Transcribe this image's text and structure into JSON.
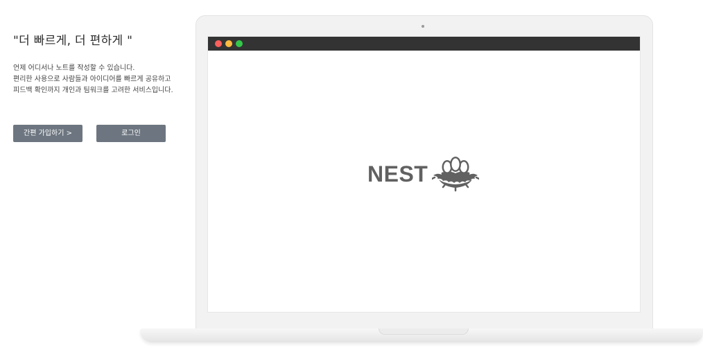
{
  "hero": {
    "headline": "\"더 빠르게, 더 편하게 \"",
    "description_lines": [
      "언제 어디서나 노트를 작성할 수 있습니다.",
      "편리한 사용으로 사람들과 아이디어를 빠르게 공유하고",
      "피드백 확인까지 개인과 팀워크를 고려한 서비스입니다."
    ]
  },
  "buttons": {
    "signup_label": "간편 가입하기 >",
    "login_label": "로그인"
  },
  "mockup": {
    "logo_text": "NEST",
    "logo_icon": "nest-eggs-icon",
    "window_controls": [
      "close",
      "minimize",
      "maximize"
    ]
  },
  "colors": {
    "button_bg": "#6d7680",
    "browser_bar": "#333333",
    "logo": "#616161",
    "dot_red": "#fc605c",
    "dot_yellow": "#fdbc40",
    "dot_green": "#34c84a"
  }
}
